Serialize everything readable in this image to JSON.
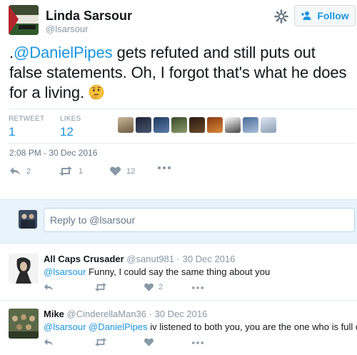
{
  "tweet": {
    "author_name": "Linda Sarsour",
    "author_handle": "@lsarsour",
    "follow_label": "Follow",
    "text_prefix": ".",
    "text_mention": "@DanielPipes",
    "text_rest": " gets refuted and still puts out false statements. Oh, I forgot that's what he does for a living. ",
    "emoji": "thinking-face-emoji",
    "retweet_label": "RETWEET",
    "retweet_count": "1",
    "likes_label": "LIKES",
    "likes_count": "12",
    "timestamp": "2:08 PM - 30 Dec 2016",
    "actions": {
      "reply_count": "2",
      "retweet_count": "1",
      "like_count": "12"
    }
  },
  "reply_box": {
    "placeholder": "Reply to @lsarsour"
  },
  "replies": [
    {
      "name": "All Caps Crusader",
      "handle": "@sanut981",
      "date": "· 30 Dec 2016",
      "mention": "@lsarsour",
      "text": " Funny, I could say the same thing about you",
      "like_count": "2"
    },
    {
      "name": "Mike",
      "handle": "@CinderellaMan36",
      "date": "· 30 Dec 2016",
      "mention": "@lsarsour @DanielPipes",
      "text": " iv listened to both you, you are the one who is full of it",
      "like_count": ""
    }
  ],
  "colors": {
    "link": "#1b95e0",
    "muted": "#8899a6",
    "reply_bg": "#e8f4fb"
  }
}
